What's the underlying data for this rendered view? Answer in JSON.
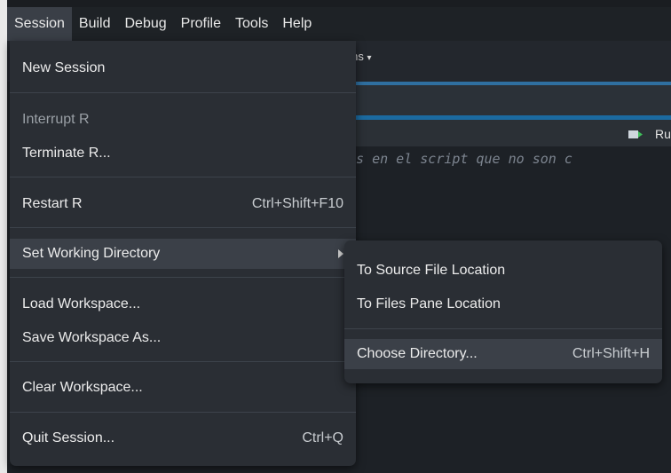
{
  "menubar": {
    "items": [
      "Session",
      "Build",
      "Debug",
      "Profile",
      "Tools",
      "Help"
    ]
  },
  "background": {
    "addins_label": "dins",
    "run_label": "Ru",
    "code_text": "as en el script que no son c"
  },
  "session_menu": {
    "new_session": "New Session",
    "interrupt": "Interrupt R",
    "terminate": "Terminate R...",
    "restart": "Restart R",
    "restart_shortcut": "Ctrl+Shift+F10",
    "set_wd": "Set Working Directory",
    "load_ws": "Load Workspace...",
    "save_ws": "Save Workspace As...",
    "clear_ws": "Clear Workspace...",
    "quit": "Quit Session...",
    "quit_shortcut": "Ctrl+Q"
  },
  "wd_submenu": {
    "source_file": "To Source File Location",
    "files_pane": "To Files Pane Location",
    "choose_dir": "Choose Directory...",
    "choose_dir_shortcut": "Ctrl+Shift+H"
  }
}
